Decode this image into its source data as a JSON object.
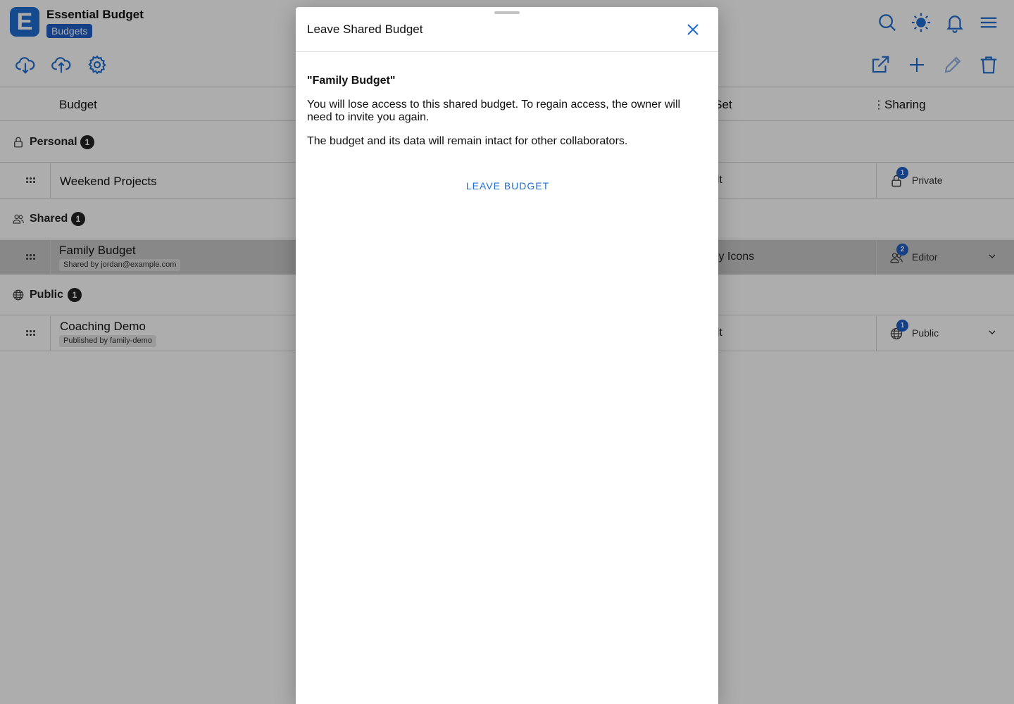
{
  "app": {
    "logo_letter": "E",
    "title": "Essential Budget",
    "section_badge": "Budgets",
    "accent_color": "#1f6fd1"
  },
  "header_icons": {
    "right": [
      "search-icon",
      "theme-sun-icon",
      "notifications-bell-icon",
      "menu-icon"
    ],
    "toolbar_left": [
      "cloud-download-icon",
      "cloud-upload-icon",
      "settings-gear-icon"
    ],
    "toolbar_right": [
      "open-external-icon",
      "add-plus-icon",
      "edit-pencil-icon",
      "delete-trash-icon"
    ]
  },
  "table": {
    "columns": {
      "budget": "Budget",
      "icon_set": "n Set",
      "sharing": "Sharing"
    },
    "groups": [
      {
        "label": "Personal",
        "count": "1",
        "icon": "lock-icon",
        "items": [
          {
            "name": "Weekend Projects",
            "subtitle": "",
            "icon_set": "ault",
            "sharing_label": "Private",
            "sharing_count": "1",
            "sharing_icon": "lock-icon"
          }
        ]
      },
      {
        "label": "Shared",
        "count": "1",
        "icon": "users-icon",
        "items": [
          {
            "name": "Family Budget",
            "subtitle": "Shared by jordan@example.com",
            "icon_set": "mily Icons",
            "sharing_label": "Editor",
            "sharing_count": "2",
            "sharing_icon": "users-icon"
          }
        ]
      },
      {
        "label": "Public",
        "count": "1",
        "icon": "globe-icon",
        "items": [
          {
            "name": "Coaching Demo",
            "subtitle": "Published by family-demo",
            "icon_set": "ault",
            "sharing_label": "Public",
            "sharing_count": "1",
            "sharing_icon": "globe-icon"
          }
        ]
      }
    ]
  },
  "modal": {
    "title": "Leave Shared Budget",
    "budget_name": "\"Family Budget\"",
    "paragraph_1": "You will lose access to this shared budget. To regain access, the owner will need to invite you again.",
    "paragraph_2": "The budget and its data will remain intact for other collaborators.",
    "action_label": "LEAVE BUDGET"
  }
}
